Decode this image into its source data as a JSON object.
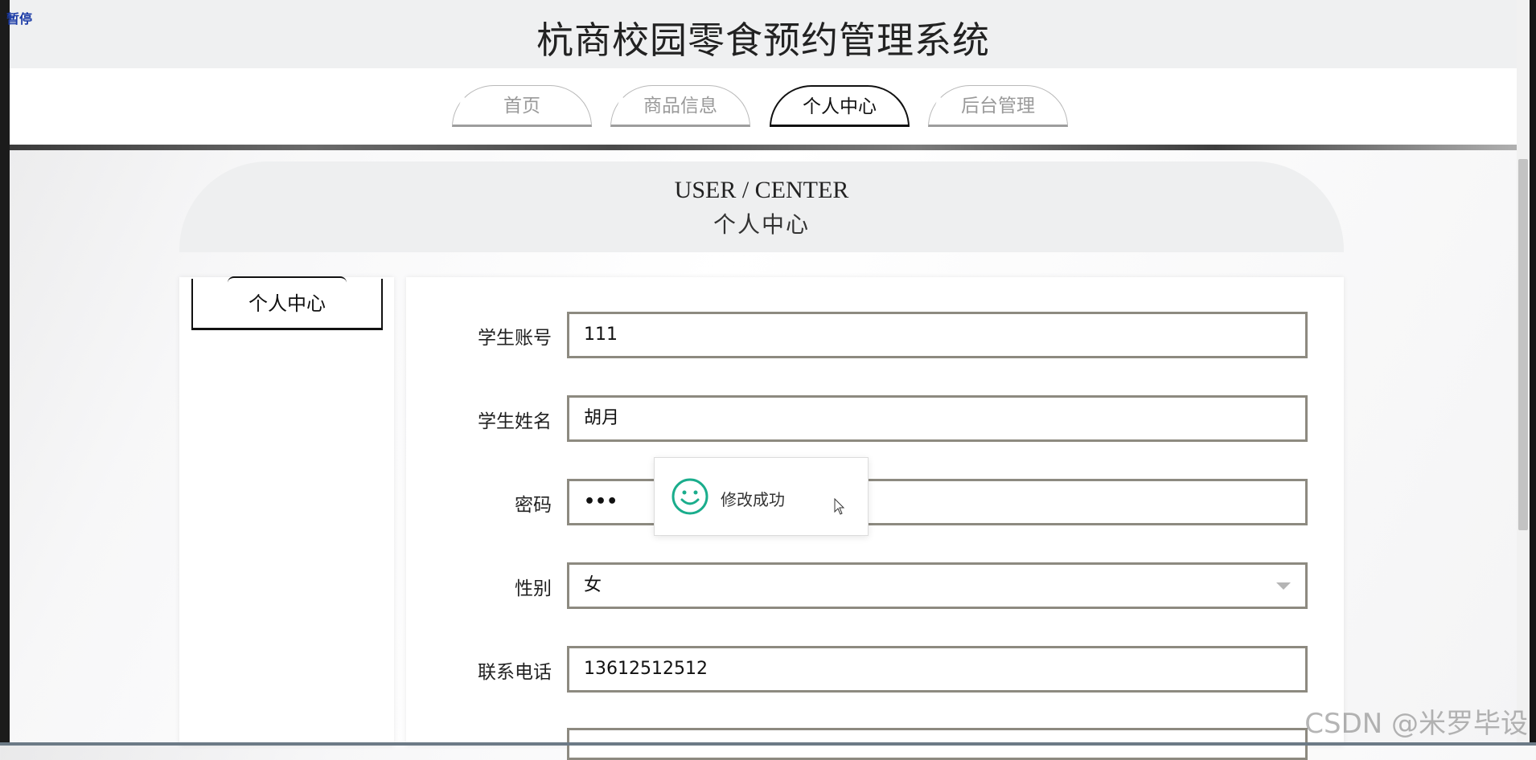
{
  "overlay": {
    "pause_label": "暂停"
  },
  "site": {
    "title": "杭商校园零食预约管理系统"
  },
  "nav": {
    "tabs": [
      {
        "label": "首页",
        "active": false
      },
      {
        "label": "商品信息",
        "active": false
      },
      {
        "label": "个人中心",
        "active": true
      },
      {
        "label": "后台管理",
        "active": false
      }
    ]
  },
  "page": {
    "title_en": "USER / CENTER",
    "title_cn": "个人中心"
  },
  "sidebar": {
    "items": [
      {
        "label": "个人中心",
        "active": true
      }
    ]
  },
  "form": {
    "fields": [
      {
        "label": "学生账号",
        "value": "111"
      },
      {
        "label": "学生姓名",
        "value": "胡月"
      },
      {
        "label": "密码",
        "value": "•••"
      },
      {
        "label": "性别",
        "value": "女"
      },
      {
        "label": "联系电话",
        "value": "13612512512"
      }
    ]
  },
  "toast": {
    "message": "修改成功",
    "accent_color": "#1aad8c"
  },
  "watermark": {
    "text": "CSDN @米罗毕设"
  }
}
